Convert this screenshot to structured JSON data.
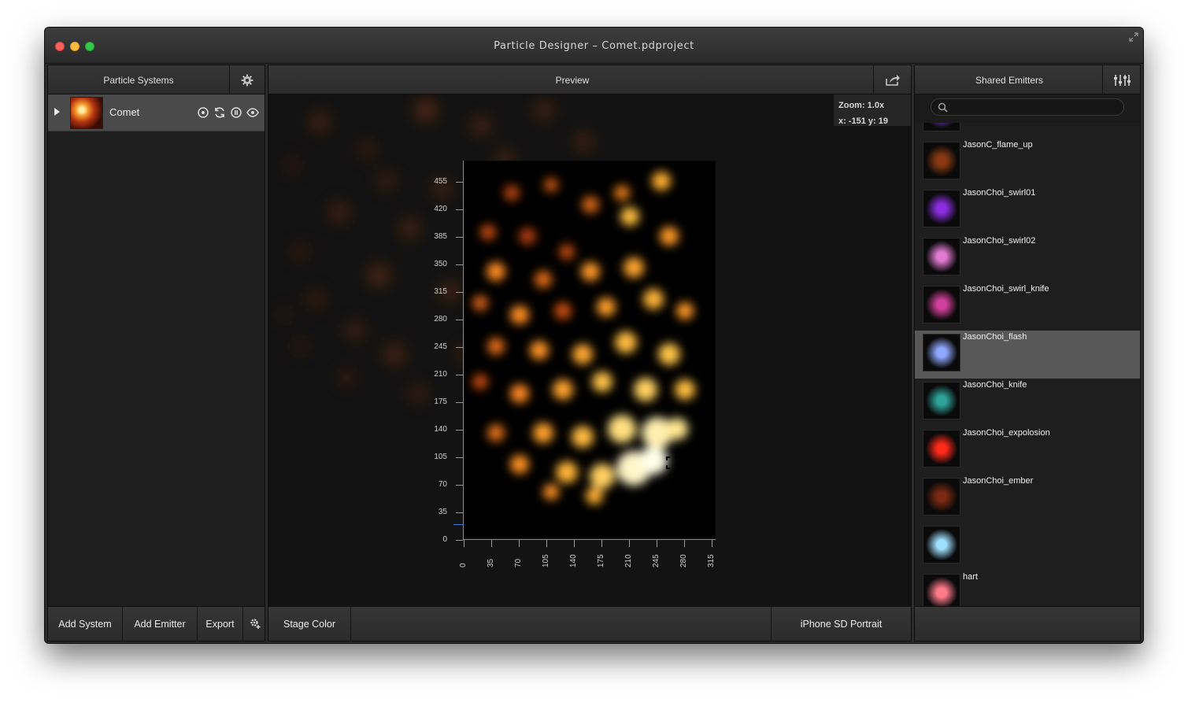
{
  "window": {
    "title": "Particle Designer – Comet.pdproject"
  },
  "left_panel": {
    "header": "Particle Systems",
    "systems": [
      {
        "name": "Comet"
      }
    ],
    "footer": {
      "add_system": "Add System",
      "add_emitter": "Add Emitter",
      "export": "Export"
    }
  },
  "center_panel": {
    "header": "Preview",
    "zoom": "Zoom: 1.0x",
    "coords": "x: -151 y: 19",
    "y_ticks": [
      "455",
      "420",
      "385",
      "350",
      "315",
      "280",
      "245",
      "210",
      "175",
      "140",
      "105",
      "70",
      "35",
      "0"
    ],
    "x_ticks": [
      "0",
      "35",
      "70",
      "105",
      "140",
      "175",
      "210",
      "245",
      "280",
      "315"
    ],
    "footer": {
      "stage_color": "Stage Color",
      "device": "iPhone SD Portrait"
    }
  },
  "right_panel": {
    "header": "Shared Emitters",
    "search_placeholder": "",
    "emitters": [
      {
        "name": "",
        "swatch": "#7a3cc8"
      },
      {
        "name": "JasonC_flame_up",
        "swatch": "#8a3a12"
      },
      {
        "name": "JasonChoi_swirl01",
        "swatch": "#8a2ee0"
      },
      {
        "name": "JasonChoi_swirl02",
        "swatch": "#e07ad0"
      },
      {
        "name": "JasonChoi_swirl_knife",
        "swatch": "#d0409a"
      },
      {
        "name": "JasonChoi_flash",
        "swatch": "#8fa8ff"
      },
      {
        "name": "JasonChoi_knife",
        "swatch": "#2ea39a"
      },
      {
        "name": "JasonChoi_expolosion",
        "swatch": "#ff2a1a"
      },
      {
        "name": "JasonChoi_ember",
        "swatch": "#7a2a12"
      },
      {
        "name": "",
        "swatch": "#9fe0ff"
      },
      {
        "name": "hart",
        "swatch": "#ff7a8a"
      }
    ],
    "selected_index": 5
  },
  "colors": {
    "window_bg": "#2b2b2b",
    "selected_row": "#585858",
    "stage_bg": "#131313"
  }
}
